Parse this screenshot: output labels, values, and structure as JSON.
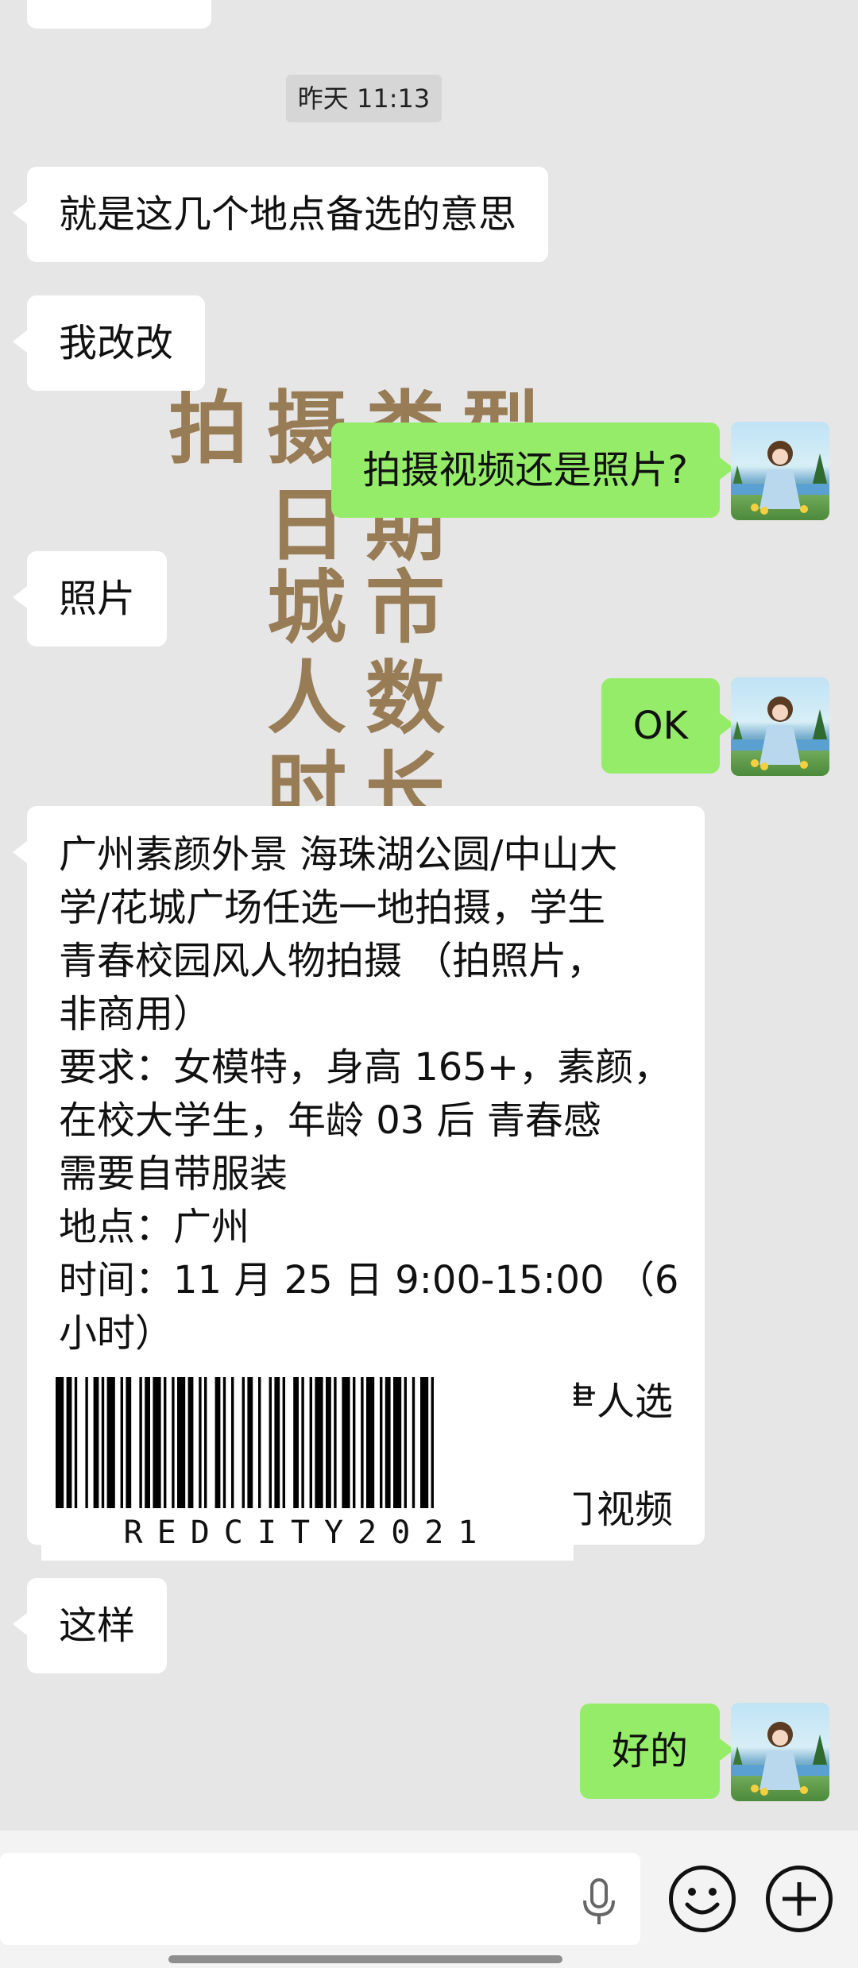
{
  "timestamp": "昨天 11:13",
  "messages": {
    "m1": "就是这几个地点备选的意思",
    "m2": "我改改",
    "m3": "拍摄视频还是照片?",
    "m4": "照片",
    "m5": "OK",
    "m7": "这样",
    "m8": "好的"
  },
  "card": {
    "lines": [
      "广州素颜外景 海珠湖公圆/中山大",
      "学/花城广场任选一地拍摄，学生",
      "青春校园风人物拍摄 （拍照片，",
      "非商用）",
      "要求：女模特，身高 165+，素颜，",
      "在校大学生，年龄 03 后  青春感",
      "需要自带服装",
      "地点：广州",
      "时间：11 月 25 日 9:00-15:00 （6",
      "小时）"
    ],
    "tail1": "⺻人选",
    "tail2": "⺆视频"
  },
  "watermark": {
    "col1": [
      "拍"
    ],
    "col2": [
      "摄",
      "日",
      "城",
      "人",
      "时"
    ],
    "col3": [
      "类",
      "期",
      "市",
      "数",
      "长"
    ],
    "col4": [
      "型"
    ]
  },
  "barcode": {
    "label": "REDCITY2021",
    "bars": [
      3,
      1,
      2,
      1,
      1,
      3,
      1,
      2,
      2,
      1,
      1,
      1,
      3,
      2,
      1,
      1,
      2,
      3,
      1,
      1,
      2,
      1,
      3,
      1,
      1,
      2,
      1,
      1,
      3,
      1,
      2,
      2,
      1,
      1,
      1,
      3,
      2,
      1,
      1,
      2,
      1,
      3,
      1,
      1,
      2,
      2,
      1,
      3,
      1,
      1,
      2,
      1,
      1,
      3,
      2,
      1,
      1,
      2,
      1,
      1,
      3,
      1,
      2,
      1,
      1,
      2,
      3,
      1,
      1,
      2,
      1,
      1,
      3,
      2,
      1,
      1,
      2,
      1,
      3,
      1,
      1,
      2,
      1,
      2,
      3,
      1,
      1,
      2
    ]
  }
}
